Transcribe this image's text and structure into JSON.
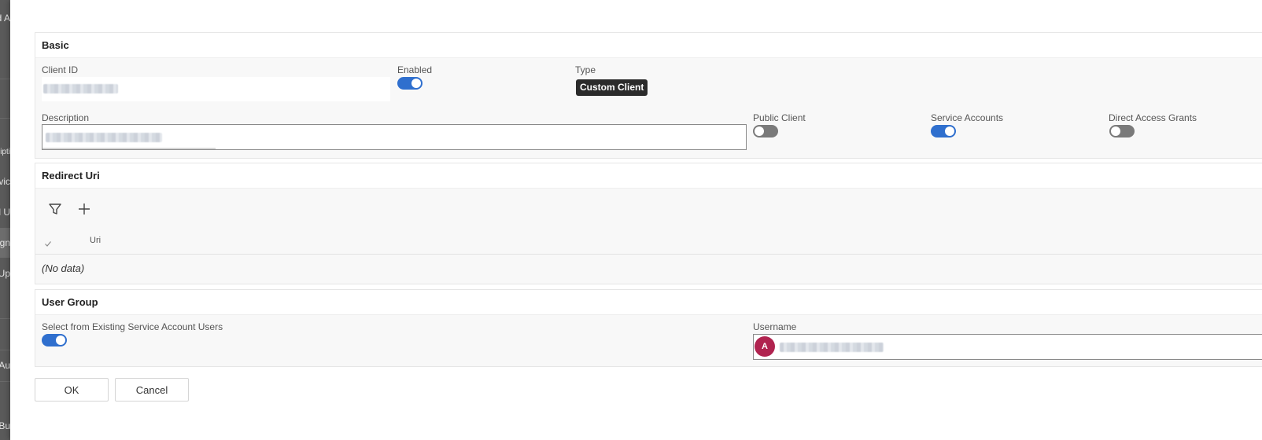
{
  "background_app": {
    "items": [
      "d A",
      "cripti",
      "vic",
      "d U",
      "gn",
      "Up",
      "Au",
      "Bu"
    ]
  },
  "basic": {
    "title": "Basic",
    "client_id": {
      "label": "Client ID"
    },
    "enabled": {
      "label": "Enabled",
      "value": true
    },
    "type": {
      "label": "Type",
      "value": "Custom Client"
    },
    "description": {
      "label": "Description"
    },
    "public_client": {
      "label": "Public Client",
      "value": false
    },
    "service_accounts": {
      "label": "Service Accounts",
      "value": true
    },
    "direct_access_grants": {
      "label": "Direct Access Grants",
      "value": false
    }
  },
  "redirect_uri": {
    "title": "Redirect Uri",
    "column_header": "Uri",
    "empty_text": "(No data)"
  },
  "user_group": {
    "title": "User Group",
    "select_existing": {
      "label": "Select from Existing Service Account Users",
      "value": true
    },
    "username": {
      "label": "Username",
      "avatar_letter": "A"
    }
  },
  "footer": {
    "ok_label": "OK",
    "cancel_label": "Cancel"
  },
  "colors": {
    "toggle_on": "#2f6fce",
    "toggle_off": "#7a7a7a",
    "avatar": "#b0234f",
    "badge": "#2b2b2b"
  }
}
